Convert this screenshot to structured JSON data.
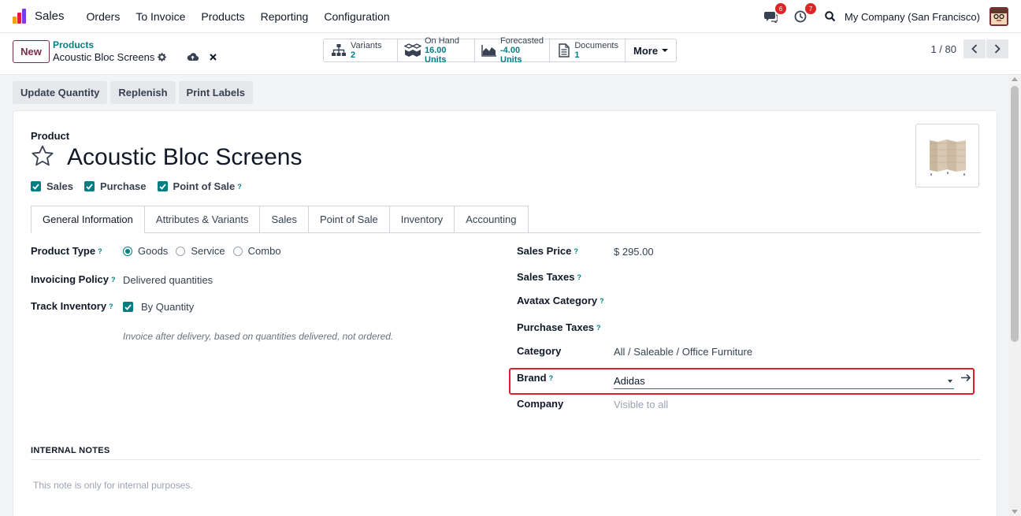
{
  "navbar": {
    "app_name": "Sales",
    "menu": [
      "Orders",
      "To Invoice",
      "Products",
      "Reporting",
      "Configuration"
    ],
    "messages_count": "6",
    "activities_count": "7",
    "company": "My Company (San Francisco)"
  },
  "control": {
    "new_label": "New",
    "breadcrumb_parent": "Products",
    "breadcrumb_current": "Acoustic Bloc Screens",
    "stats": [
      {
        "label": "Variants",
        "value": "2",
        "icon": "variants-icon"
      },
      {
        "label": "On Hand",
        "value": "16.00 Units",
        "icon": "cubes-icon"
      },
      {
        "label": "Forecasted",
        "value": "-4.00 Units",
        "icon": "area-chart-icon"
      },
      {
        "label": "Documents",
        "value": "1",
        "icon": "document-icon"
      }
    ],
    "more_label": "More",
    "pager": "1 / 80"
  },
  "actions": [
    "Update Quantity",
    "Replenish",
    "Print Labels"
  ],
  "product": {
    "label": "Product",
    "name": "Acoustic Bloc Screens",
    "checks": [
      "Sales",
      "Purchase",
      "Point of Sale"
    ]
  },
  "tabs": [
    "General Information",
    "Attributes & Variants",
    "Sales",
    "Point of Sale",
    "Inventory",
    "Accounting"
  ],
  "left_fields": {
    "product_type_label": "Product Type",
    "product_type_options": [
      "Goods",
      "Service",
      "Combo"
    ],
    "invoicing_policy_label": "Invoicing Policy",
    "invoicing_policy_value": "Delivered quantities",
    "track_inventory_label": "Track Inventory",
    "track_inventory_value": "By Quantity",
    "hint": "Invoice after delivery, based on quantities delivered, not ordered."
  },
  "right_fields": {
    "sales_price_label": "Sales Price",
    "sales_price_value": "$ 295.00",
    "sales_taxes_label": "Sales Taxes",
    "avatax_label": "Avatax Category",
    "purchase_taxes_label": "Purchase Taxes",
    "category_label": "Category",
    "category_value": "All / Saleable / Office Furniture",
    "brand_label": "Brand",
    "brand_value": "Adidas",
    "company_label": "Company",
    "company_value": "Visible to all"
  },
  "internal_notes": {
    "heading": "INTERNAL NOTES",
    "placeholder": "This note is only for internal purposes."
  },
  "colors": {
    "accent": "#017e84",
    "brand": "#7c2b4a",
    "highlight": "#e11d2a"
  }
}
